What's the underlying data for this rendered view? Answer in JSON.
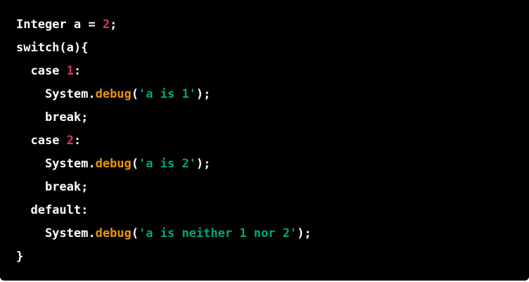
{
  "colors": {
    "background": "#000000",
    "text": "#ffffff",
    "number": "#df3079",
    "method": "#e9950c",
    "string": "#00a67d"
  },
  "code": {
    "lines": [
      [
        {
          "t": "Integer a = ",
          "k": "text"
        },
        {
          "t": "2",
          "k": "number"
        },
        {
          "t": ";",
          "k": "punct"
        }
      ],
      [
        {
          "t": "switch(a){",
          "k": "text"
        }
      ],
      [
        {
          "t": "  case ",
          "k": "text"
        },
        {
          "t": "1",
          "k": "number"
        },
        {
          "t": ":",
          "k": "punct"
        }
      ],
      [
        {
          "t": "    System.",
          "k": "text"
        },
        {
          "t": "debug",
          "k": "method"
        },
        {
          "t": "(",
          "k": "punct"
        },
        {
          "t": "'a is 1'",
          "k": "string"
        },
        {
          "t": ");",
          "k": "punct"
        }
      ],
      [
        {
          "t": "    break;",
          "k": "text"
        }
      ],
      [
        {
          "t": "  case ",
          "k": "text"
        },
        {
          "t": "2",
          "k": "number"
        },
        {
          "t": ":",
          "k": "punct"
        }
      ],
      [
        {
          "t": "    System.",
          "k": "text"
        },
        {
          "t": "debug",
          "k": "method"
        },
        {
          "t": "(",
          "k": "punct"
        },
        {
          "t": "'a is 2'",
          "k": "string"
        },
        {
          "t": ");",
          "k": "punct"
        }
      ],
      [
        {
          "t": "    break;",
          "k": "text"
        }
      ],
      [
        {
          "t": "  default:",
          "k": "text"
        }
      ],
      [
        {
          "t": "    System.",
          "k": "text"
        },
        {
          "t": "debug",
          "k": "method"
        },
        {
          "t": "(",
          "k": "punct"
        },
        {
          "t": "'a is neither 1 nor 2'",
          "k": "string"
        },
        {
          "t": ");",
          "k": "punct"
        }
      ],
      [
        {
          "t": "}",
          "k": "text"
        }
      ]
    ]
  }
}
